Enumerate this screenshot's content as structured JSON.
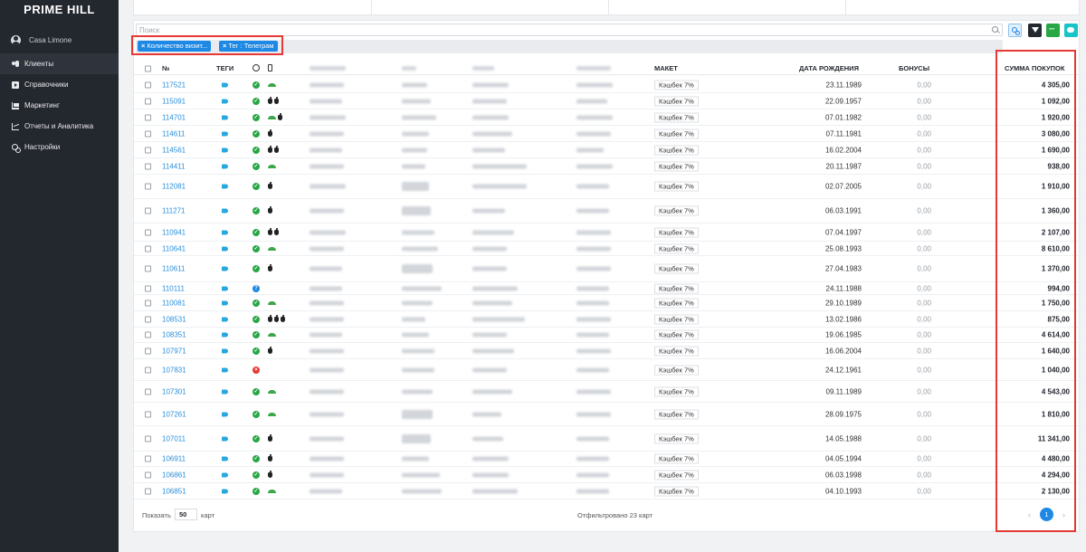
{
  "sidebar": {
    "brand": "PRIME HILL",
    "account_name": "Casa Limone",
    "items": [
      {
        "label": "Клиенты",
        "icon": "users-icon",
        "active": true
      },
      {
        "label": "Справочники",
        "icon": "book-icon",
        "active": false
      },
      {
        "label": "Маркетинг",
        "icon": "cart-icon",
        "active": false
      },
      {
        "label": "Отчеты и Аналитика",
        "icon": "chart-icon",
        "active": false
      },
      {
        "label": "Настройки",
        "icon": "settings-icon",
        "active": false
      }
    ]
  },
  "search": {
    "placeholder": "Поиск"
  },
  "filters": {
    "chip_remove": "×",
    "chips": [
      "Количество визит...",
      "Тег : Телеграм"
    ]
  },
  "table": {
    "headers": {
      "number": "№",
      "tags": "ТЕГИ",
      "maket": "МАКЕТ",
      "dob": "ДАТА РОЖДЕНИЯ",
      "bonus": "БОНУСЫ",
      "sum": "СУММА ПОКУПОК"
    },
    "rows": [
      {
        "id": "117521",
        "status": "ok",
        "devices": [
          "android"
        ],
        "maket": "Кэшбек 7%",
        "dob": "23.11.1989",
        "bonus": "0,00",
        "sum": "4 305,00"
      },
      {
        "id": "115091",
        "status": "ok",
        "devices": [
          "apple",
          "apple"
        ],
        "maket": "Кэшбек 7%",
        "dob": "22.09.1957",
        "bonus": "0,00",
        "sum": "1 092,00"
      },
      {
        "id": "114701",
        "status": "ok",
        "devices": [
          "android",
          "apple"
        ],
        "maket": "Кэшбек 7%",
        "dob": "07.01.1982",
        "bonus": "0,00",
        "sum": "1 920,00"
      },
      {
        "id": "114611",
        "status": "ok",
        "devices": [
          "apple"
        ],
        "maket": "Кэшбек 7%",
        "dob": "07.11.1981",
        "bonus": "0,00",
        "sum": "3 080,00"
      },
      {
        "id": "114561",
        "status": "ok",
        "devices": [
          "apple",
          "apple"
        ],
        "maket": "Кэшбек 7%",
        "dob": "16.02.2004",
        "bonus": "0,00",
        "sum": "1 690,00"
      },
      {
        "id": "114411",
        "status": "ok",
        "devices": [
          "android"
        ],
        "maket": "Кэшбек 7%",
        "dob": "20.11.1987",
        "bonus": "0,00",
        "sum": "938,00"
      },
      {
        "id": "112081",
        "status": "ok",
        "devices": [
          "apple"
        ],
        "maket": "Кэшбек 7%",
        "dob": "02.07.2005",
        "bonus": "0,00",
        "sum": "1 910,00"
      },
      {
        "id": "111271",
        "status": "ok",
        "devices": [
          "apple"
        ],
        "maket": "Кэшбек 7%",
        "dob": "06.03.1991",
        "bonus": "0,00",
        "sum": "1 360,00"
      },
      {
        "id": "110941",
        "status": "ok",
        "devices": [
          "apple",
          "apple"
        ],
        "maket": "Кэшбек 7%",
        "dob": "07.04.1997",
        "bonus": "0,00",
        "sum": "2 107,00"
      },
      {
        "id": "110641",
        "status": "ok",
        "devices": [
          "android"
        ],
        "maket": "Кэшбек 7%",
        "dob": "25.08.1993",
        "bonus": "0,00",
        "sum": "8 610,00"
      },
      {
        "id": "110611",
        "status": "ok",
        "devices": [
          "apple"
        ],
        "maket": "Кэшбек 7%",
        "dob": "27.04.1983",
        "bonus": "0,00",
        "sum": "1 370,00"
      },
      {
        "id": "110111",
        "status": "q",
        "devices": [],
        "maket": "Кэшбек 7%",
        "dob": "24.11.1988",
        "bonus": "0,00",
        "sum": "994,00"
      },
      {
        "id": "110081",
        "status": "ok",
        "devices": [
          "android"
        ],
        "maket": "Кэшбек 7%",
        "dob": "29.10.1989",
        "bonus": "0,00",
        "sum": "1 750,00"
      },
      {
        "id": "108531",
        "status": "ok",
        "devices": [
          "apple",
          "apple",
          "apple"
        ],
        "maket": "Кэшбек 7%",
        "dob": "13.02.1986",
        "bonus": "0,00",
        "sum": "875,00"
      },
      {
        "id": "108351",
        "status": "ok",
        "devices": [
          "android"
        ],
        "maket": "Кэшбек 7%",
        "dob": "19.06.1985",
        "bonus": "0,00",
        "sum": "4 614,00"
      },
      {
        "id": "107971",
        "status": "ok",
        "devices": [
          "apple"
        ],
        "maket": "Кэшбек 7%",
        "dob": "16.06.2004",
        "bonus": "0,00",
        "sum": "1 640,00"
      },
      {
        "id": "107831",
        "status": "x",
        "devices": [],
        "maket": "Кэшбек 7%",
        "dob": "24.12.1961",
        "bonus": "0,00",
        "sum": "1 040,00"
      },
      {
        "id": "107301",
        "status": "ok",
        "devices": [
          "android"
        ],
        "maket": "Кэшбек 7%",
        "dob": "09.11.1989",
        "bonus": "0,00",
        "sum": "4 543,00"
      },
      {
        "id": "107261",
        "status": "ok",
        "devices": [
          "android"
        ],
        "maket": "Кэшбек 7%",
        "dob": "28.09.1975",
        "bonus": "0,00",
        "sum": "1 810,00"
      },
      {
        "id": "107011",
        "status": "ok",
        "devices": [
          "apple"
        ],
        "maket": "Кэшбек 7%",
        "dob": "14.05.1988",
        "bonus": "0,00",
        "sum": "11 341,00"
      },
      {
        "id": "106911",
        "status": "ok",
        "devices": [
          "apple"
        ],
        "maket": "Кэшбек 7%",
        "dob": "04.05.1994",
        "bonus": "0,00",
        "sum": "4 480,00"
      },
      {
        "id": "106861",
        "status": "ok",
        "devices": [
          "apple"
        ],
        "maket": "Кэшбек 7%",
        "dob": "06.03.1998",
        "bonus": "0,00",
        "sum": "4 294,00"
      },
      {
        "id": "106851",
        "status": "ok",
        "devices": [
          "android"
        ],
        "maket": "Кэшбек 7%",
        "dob": "04.10.1993",
        "bonus": "0,00",
        "sum": "2 130,00"
      }
    ]
  },
  "footer": {
    "show_label": "Показать",
    "page_size": "50",
    "cards_label": "карт",
    "filtered_text": "Отфильтровано 23 карт",
    "prev": "‹",
    "current_page": "1",
    "next": "›"
  },
  "colors": {
    "sidebar_bg": "#23272e",
    "accent": "#1e88e5",
    "highlight_box": "#e53935",
    "status_ok": "#28a745"
  }
}
